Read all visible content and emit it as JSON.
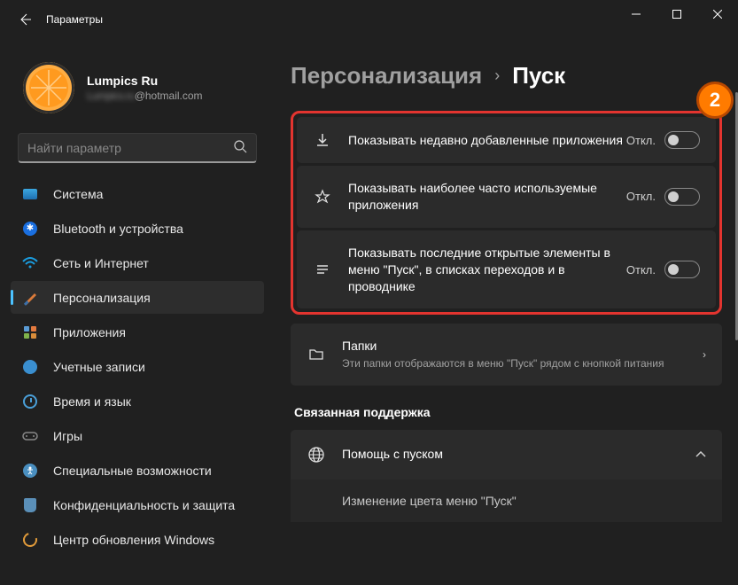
{
  "titlebar": {
    "title": "Параметры"
  },
  "profile": {
    "name": "Lumpics Ru",
    "email_obscured": "Lumpics.ru",
    "email_suffix": "@hotmail.com"
  },
  "search": {
    "placeholder": "Найти параметр"
  },
  "sidebar": {
    "items": [
      {
        "label": "Система"
      },
      {
        "label": "Bluetooth и устройства"
      },
      {
        "label": "Сеть и Интернет"
      },
      {
        "label": "Персонализация"
      },
      {
        "label": "Приложения"
      },
      {
        "label": "Учетные записи"
      },
      {
        "label": "Время и язык"
      },
      {
        "label": "Игры"
      },
      {
        "label": "Специальные возможности"
      },
      {
        "label": "Конфиденциальность и защита"
      },
      {
        "label": "Центр обновления Windows"
      }
    ]
  },
  "breadcrumb": {
    "parent": "Персонализация",
    "current": "Пуск"
  },
  "annotation": {
    "badge": "2"
  },
  "settings": [
    {
      "title": "Показывать недавно добавленные приложения",
      "state": "Откл."
    },
    {
      "title": "Показывать наиболее часто используемые приложения",
      "state": "Откл."
    },
    {
      "title": "Показывать последние открытые элементы в меню \"Пуск\", в списках переходов и в проводнике",
      "state": "Откл."
    }
  ],
  "folders": {
    "title": "Папки",
    "subtitle": "Эти папки отображаются в меню \"Пуск\" рядом с кнопкой питания"
  },
  "related_section": "Связанная поддержка",
  "help": {
    "title": "Помощь с пуском",
    "sub": "Изменение цвета меню \"Пуск\""
  }
}
